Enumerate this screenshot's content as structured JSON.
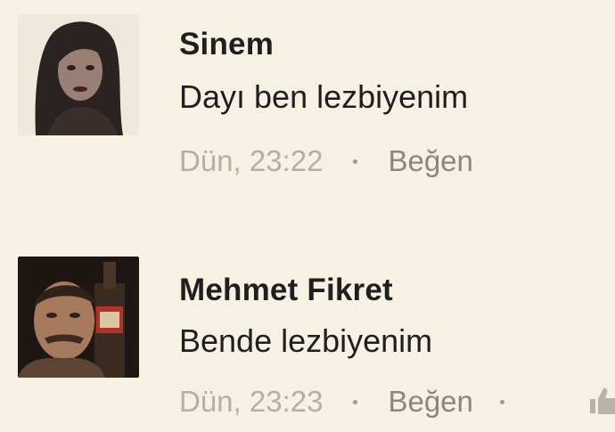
{
  "comments": [
    {
      "author": "Sinem",
      "text": "Dayı ben lezbiyenim",
      "time": "Dün, 23:22",
      "like_label": "Beğen",
      "avatar_icon": "profile-photo"
    },
    {
      "author": "Mehmet Fikret",
      "text": "Bende lezbiyenim",
      "time": "Dün, 23:23",
      "like_label": "Beğen",
      "avatar_icon": "profile-photo",
      "reaction_icon": "thumbs-up-icon"
    }
  ],
  "colors": {
    "background": "#f6f1e3",
    "name_text": "#1f1f1f",
    "meta_text": "#a9a59c"
  }
}
